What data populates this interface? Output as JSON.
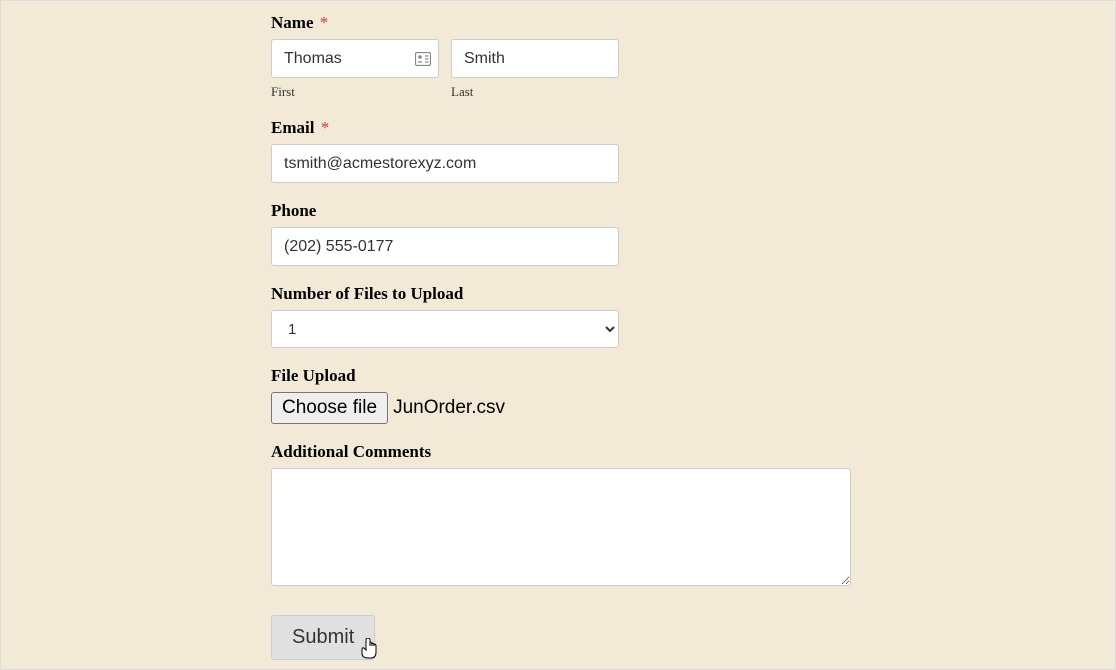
{
  "form": {
    "name": {
      "label": "Name",
      "required": true,
      "first": {
        "value": "Thomas",
        "sublabel": "First"
      },
      "last": {
        "value": "Smith",
        "sublabel": "Last"
      }
    },
    "email": {
      "label": "Email",
      "required": true,
      "value": "tsmith@acmestorexyz.com"
    },
    "phone": {
      "label": "Phone",
      "value": "(202) 555-0177"
    },
    "num_files": {
      "label": "Number of Files to Upload",
      "value": "1"
    },
    "file_upload": {
      "label": "File Upload",
      "button": "Choose file",
      "filename": "JunOrder.csv"
    },
    "comments": {
      "label": "Additional Comments",
      "value": ""
    },
    "submit": {
      "label": "Submit"
    }
  },
  "required_marker": "*"
}
